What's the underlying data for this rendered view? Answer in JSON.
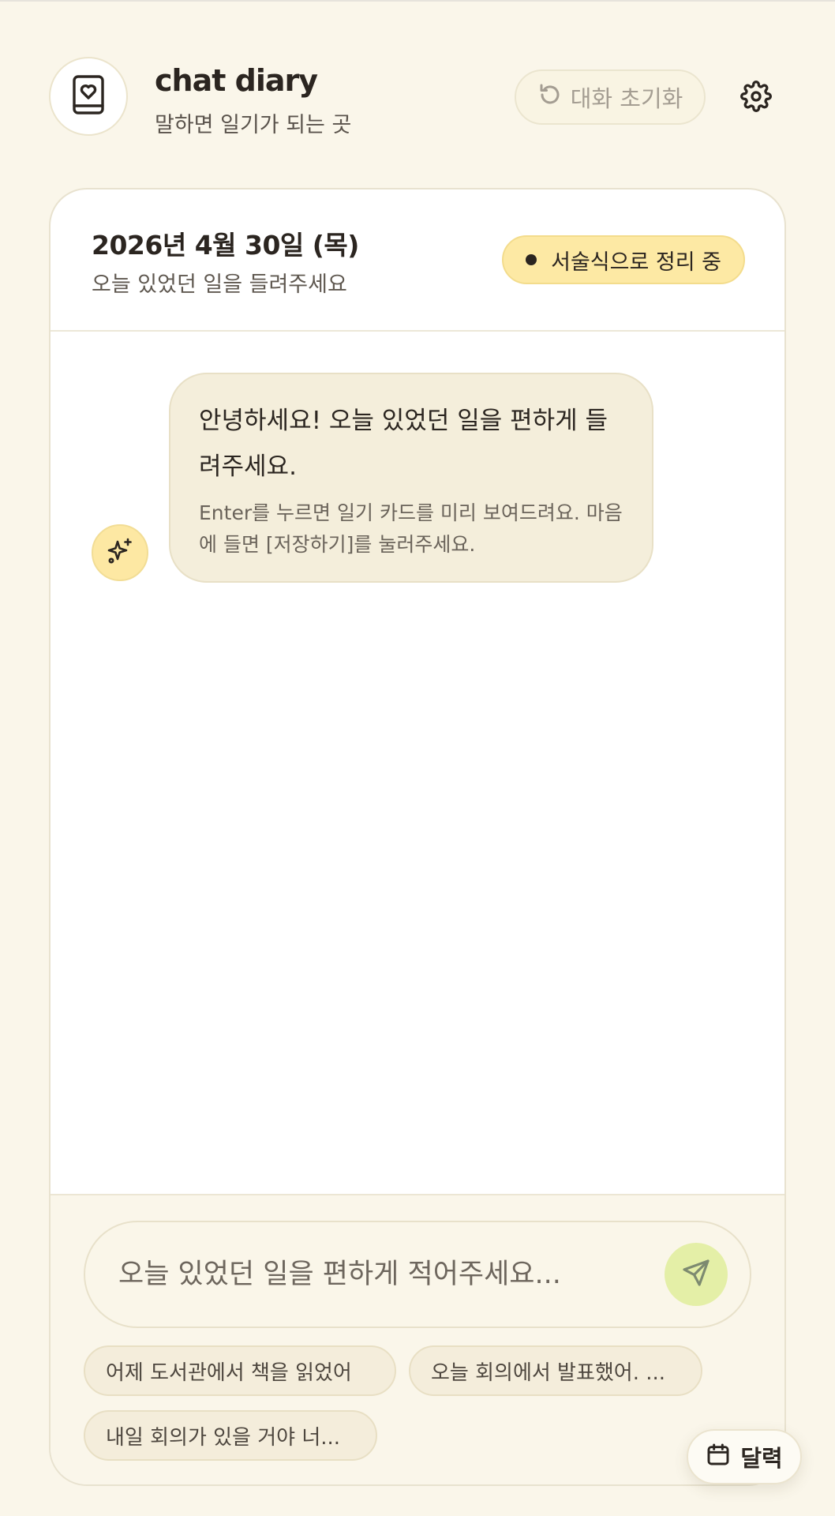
{
  "app": {
    "title": "chat diary",
    "subtitle": "말하면 일기가 되는 곳",
    "logo_icon": "diary-heart-icon",
    "reset_label": "대화 초기화",
    "reset_icon": "rotate-ccw-icon",
    "settings_icon": "gear-icon"
  },
  "card": {
    "date": "2026년 4월 30일 (목)",
    "prompt": "오늘 있었던 일을 들려주세요",
    "mode_badge": "서술식으로 정리 중"
  },
  "chat": {
    "messages": [
      {
        "role": "assistant",
        "avatar_icon": "sparkles-icon",
        "text": "안녕하세요! 오늘 있었던 일을 편하게 들려주세요.",
        "hint": "Enter를 누르면 일기 카드를 미리 보여드려요. 마음에 들면 [저장하기]를 눌러주세요."
      }
    ]
  },
  "composer": {
    "placeholder": "오늘 있었던 일을 편하게 적어주세요...",
    "value": "",
    "send_icon": "send-icon",
    "suggestions": [
      "어제 도서관에서 책을 읽었어",
      "오늘 회의에서 발표했어. ...",
      "내일 회의가 있을 거야 너..."
    ]
  },
  "calendar_button": {
    "label": "달력",
    "icon": "calendar-icon"
  },
  "colors": {
    "background": "#faf6ea",
    "card": "#ffffff",
    "bubble": "#f4eedb",
    "accent_yellow": "#fde9a4",
    "send_green": "#e4efa7",
    "text": "#2b2520"
  }
}
